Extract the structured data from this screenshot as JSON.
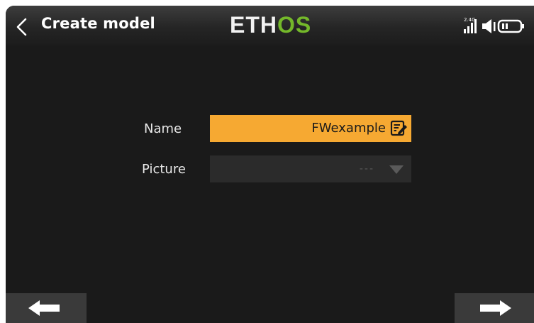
{
  "header": {
    "title": "Create model",
    "brand_part1": "ETH",
    "brand_part2": "OS",
    "rf_band": "2.4G",
    "icons": [
      "back-chevron-icon",
      "signal-bars-icon",
      "speaker-icon",
      "battery-icon"
    ]
  },
  "form": {
    "name_label": "Name",
    "name_value": "FWexample",
    "picture_label": "Picture",
    "picture_value": "---"
  },
  "footer": {
    "icons": [
      "arrow-left-icon",
      "arrow-right-icon"
    ]
  },
  "colors": {
    "background": "#1a1a1a",
    "accent": "#f6a932",
    "brand_green": "#74b82a",
    "button": "#3a3a3a",
    "field_disabled": "#2b2b2b"
  }
}
